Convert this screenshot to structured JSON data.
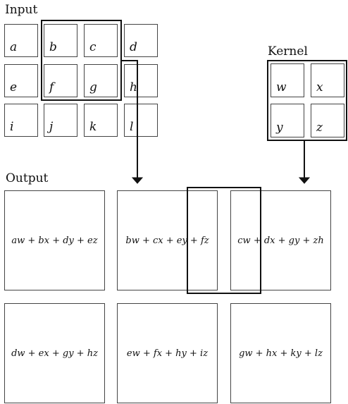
{
  "input": {
    "title": "Input",
    "cells": [
      "a",
      "b",
      "c",
      "d",
      "e",
      "f",
      "g",
      "h",
      "i",
      "j",
      "k",
      "l"
    ]
  },
  "kernel": {
    "title": "Kernel",
    "cells": [
      "w",
      "x",
      "y",
      "z"
    ]
  },
  "output": {
    "title": "Output",
    "cells": [
      "aw + bx + dy + ez",
      "bw + cx + ey + fz",
      "cw + dx + gy + zh",
      "dw + ex + gy + hz",
      "ew + fx + hy + iz",
      "gw + hx + ky + lz"
    ]
  }
}
